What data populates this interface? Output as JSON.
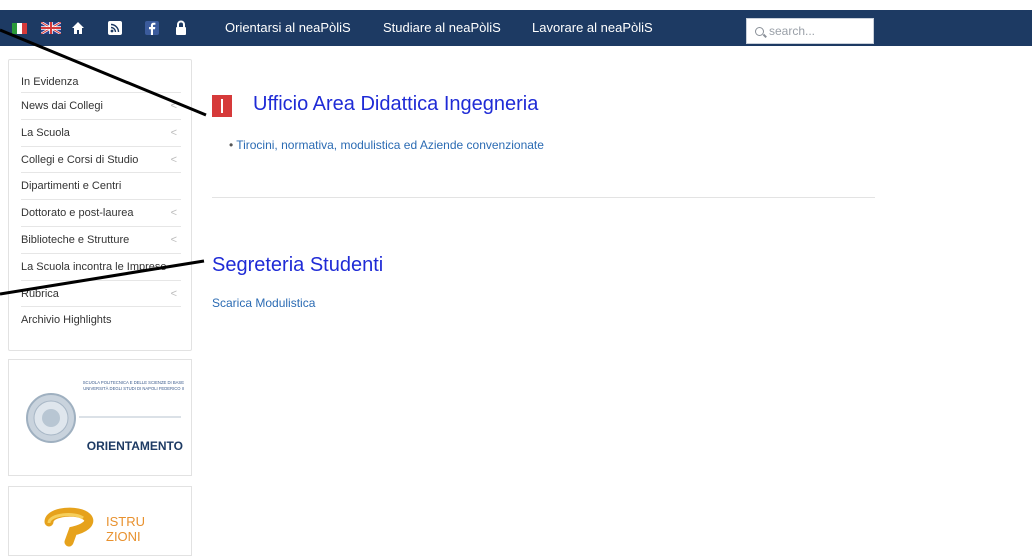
{
  "topbar": {
    "bg_color": "#1d3a63",
    "icons": [
      "italian-flag",
      "uk-flag",
      "home-icon",
      "rss-icon",
      "facebook-icon",
      "lock-icon"
    ],
    "nav": [
      {
        "label": "Orientarsi al neaPòliS"
      },
      {
        "label": "Studiare al neaPòliS"
      },
      {
        "label": "Lavorare al neaPòliS"
      }
    ],
    "search": {
      "placeholder": "search..."
    }
  },
  "sidebar": {
    "items": [
      {
        "label": "In Evidenza",
        "chevron": false
      },
      {
        "label": "News dai Collegi",
        "chevron": true
      },
      {
        "label": "La Scuola",
        "chevron": true
      },
      {
        "label": "Collegi e Corsi di Studio",
        "chevron": true
      },
      {
        "label": "Dipartimenti e Centri",
        "chevron": false
      },
      {
        "label": "Dottorato e post-laurea",
        "chevron": true
      },
      {
        "label": "Biblioteche e Strutture",
        "chevron": true
      },
      {
        "label": "La Scuola incontra le Imprese",
        "chevron": false
      },
      {
        "label": "Rubrica",
        "chevron": true
      },
      {
        "label": "Archivio Highlights",
        "chevron": false
      }
    ],
    "chevron_glyph": "<",
    "banner1": {
      "line1": "SCUOLA POLITECNICA E DELLE SCIENZE DI BASE",
      "line2": "UNIVERSITÀ DEGLI STUDI DI NAPOLI FEDERICO II",
      "title": "ORIENTAMENTO"
    },
    "banner2": {
      "line1": "ISTRU",
      "line2": "ZIONI"
    }
  },
  "main": {
    "section1": {
      "title": "Ufficio Area Didattica Ingegneria",
      "link_bullet": "•",
      "link": "Tirocini, normativa, modulistica ed Aziende convenzionate"
    },
    "section2": {
      "title": "Segreteria Studenti",
      "link": "Scarica Modulistica"
    },
    "accent_color": "#d63a3a",
    "title_color": "#1f2bd6",
    "link_color": "#2b6bb3"
  }
}
